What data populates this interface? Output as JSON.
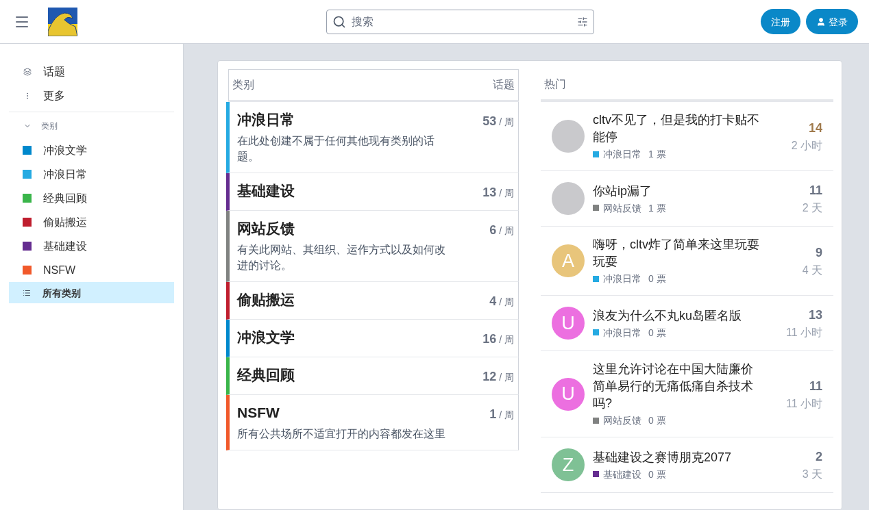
{
  "header": {
    "search": {
      "placeholder": "搜索"
    },
    "buttons": [
      {
        "label": "注册"
      },
      {
        "label": "登录"
      }
    ]
  },
  "sidebar": {
    "items": [
      {
        "label": "话题"
      },
      {
        "label": "更多"
      }
    ],
    "section": {
      "label": "类别",
      "expanded": true
    },
    "categories": [
      {
        "label": "冲浪文学",
        "color": "#0088cc",
        "selected": false
      },
      {
        "label": "冲浪日常",
        "color": "#25aae2",
        "selected": false
      },
      {
        "label": "经典回顾",
        "color": "#3ab54a",
        "selected": false
      },
      {
        "label": "偷贴搬运",
        "color": "#bf1e2e",
        "selected": false
      },
      {
        "label": "基础建设",
        "color": "#652d90",
        "selected": false
      },
      {
        "label": "NSFW",
        "color": "#f1592a",
        "selected": false
      }
    ],
    "all_categories": {
      "label": "所有类别",
      "selected": true
    }
  },
  "categories_table": {
    "columns": [
      "类别",
      "话题"
    ],
    "rows": [
      {
        "name": "冲浪日常",
        "color": "#25aae2",
        "description": "在此处创建不属于任何其他现有类别的话题。",
        "count": "53",
        "period": "/ 周"
      },
      {
        "name": "基础建设",
        "color": "#652d90",
        "count": "13",
        "period": "/ 周"
      },
      {
        "name": "网站反馈",
        "color": "#808281",
        "description": "有关此网站、其组织、运作方式以及如何改进的讨论。",
        "count": "6",
        "period": "/ 周"
      },
      {
        "name": "偷贴搬运",
        "color": "#bf1e2e",
        "count": "4",
        "period": "/ 周"
      },
      {
        "name": "冲浪文学",
        "color": "#0088cc",
        "count": "16",
        "period": "/ 周"
      },
      {
        "name": "经典回顾",
        "color": "#3ab54a",
        "count": "12",
        "period": "/ 周"
      },
      {
        "name": "NSFW",
        "color": "#f1592a",
        "description": "所有公共场所不适宜打开的内容都发在这里",
        "count": "1",
        "period": "/ 周"
      }
    ]
  },
  "hot": {
    "title": "热门",
    "topics": [
      {
        "title": "cltv不见了，但是我的打卡贴不能停",
        "avatar": {
          "kind": "image"
        },
        "category": "冲浪日常",
        "color": "#25aae2",
        "votes": "1 票",
        "replies": "14",
        "highlighted": true,
        "age": "2 小时"
      },
      {
        "title": "你站ip漏了",
        "avatar": {
          "kind": "image"
        },
        "category": "网站反馈",
        "color": "#808281",
        "votes": "1 票",
        "replies": "11",
        "highlighted": false,
        "age": "2 天"
      },
      {
        "title": "嗨呀，cltv炸了简单来这里玩耍玩耍",
        "avatar": {
          "kind": "letter",
          "letter": "A",
          "color": "#e8c57b"
        },
        "category": "冲浪日常",
        "color": "#25aae2",
        "votes": "0 票",
        "replies": "9",
        "highlighted": false,
        "age": "4 天"
      },
      {
        "title": "浪友为什么不丸ku岛匿名版",
        "avatar": {
          "kind": "letter",
          "letter": "U",
          "color": "#ec6fe0"
        },
        "category": "冲浪日常",
        "color": "#25aae2",
        "votes": "0 票",
        "replies": "13",
        "highlighted": false,
        "age": "11 小时"
      },
      {
        "title": "这里允许讨论在中国大陆廉价简单易行的无痛低痛自杀技术吗?",
        "avatar": {
          "kind": "letter",
          "letter": "U",
          "color": "#ec6fe0"
        },
        "category": "网站反馈",
        "color": "#808281",
        "votes": "0 票",
        "replies": "11",
        "highlighted": false,
        "age": "11 小时"
      },
      {
        "title": "基础建设之赛博朋克2077",
        "avatar": {
          "kind": "letter",
          "letter": "Z",
          "color": "#7fc195"
        },
        "category": "基础建设",
        "color": "#652d90",
        "votes": "0 票",
        "replies": "2",
        "highlighted": false,
        "age": "3 天"
      }
    ]
  }
}
